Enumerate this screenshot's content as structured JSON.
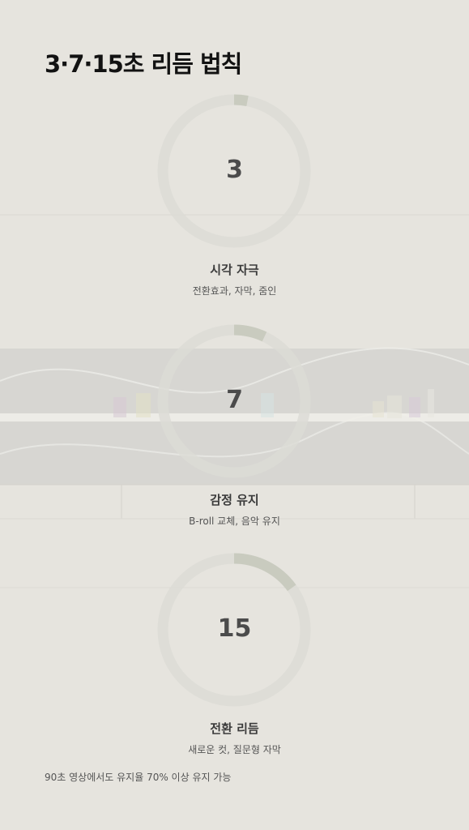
{
  "title": "3·7·15초 리듬 법칙",
  "items": [
    {
      "number": "3",
      "label": "시각 자극",
      "sub": "전환효과, 자막, 줌인",
      "fraction": 0.03
    },
    {
      "number": "7",
      "label": "감정 유지",
      "sub": "B-roll 교체, 음악 유지",
      "fraction": 0.07
    },
    {
      "number": "15",
      "label": "전환 리듬",
      "sub": "새로운 컷, 질문형 자막",
      "fraction": 0.15
    }
  ],
  "footer": "90초 영상에서도 유지율 70% 이상 유지 가능",
  "colors": {
    "background": "#e5e3dd",
    "ring_track": "#dcdcd6",
    "ring_fill": "#c9cbbf"
  }
}
